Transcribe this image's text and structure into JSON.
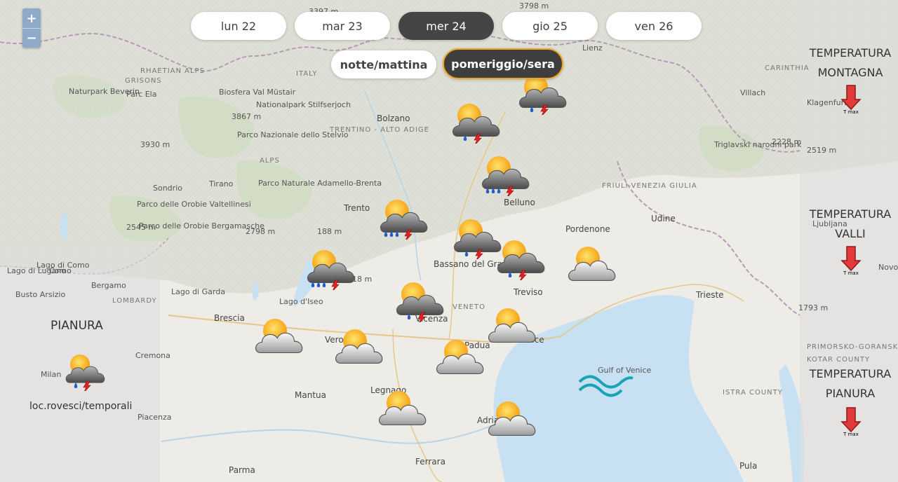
{
  "days": [
    "lun 22",
    "mar 23",
    "mer 24",
    "gio 25",
    "ven 26"
  ],
  "active_day": 2,
  "periods": [
    "notte/mattina",
    "pomeriggio/sera"
  ],
  "active_period": 1,
  "zoom": {
    "in": "+",
    "out": "−"
  },
  "right_panel": [
    {
      "title_1": "TEMPERATURA",
      "title_2": "MONTAGNA",
      "tmax": "T max"
    },
    {
      "title_1": "TEMPERATURA",
      "title_2": "VALLI",
      "tmax": "T max"
    },
    {
      "title_1": "TEMPERATURA",
      "title_2": "PIANURA",
      "tmax": "T max"
    }
  ],
  "left_panel": {
    "title": "PIANURA",
    "legend": "loc.rovesci/temporali"
  },
  "place_labels": [
    "Lienz",
    "Villach",
    "Klagenfurt",
    "CARINTHIA",
    "Bolzano",
    "ITALY",
    "TRENTINO - ALTO ADIGE",
    "Naturpark Beverin",
    "Parc Ela",
    "GRISONS",
    "RHAETIAN ALPS",
    "Biosfera Val Müstair",
    "Nationalpark Stilfserjoch",
    "Parco Nazionale dello Stelvio",
    "Parco Naturale Adamello-Brenta",
    "Sondrio",
    "Tirano",
    "Parco delle Orobie Valtellinesi",
    "Parco delle Orobie Bergamasche",
    "Trento",
    "Belluno",
    "FRIULI-VENEZIA GIULIA",
    "Udine",
    "Pordenone",
    "Bassano del Grappa",
    "Treviso",
    "VENETO",
    "Vicenza",
    "Venice",
    "Trieste",
    "Triglavski narodni park",
    "Ljubljana",
    "Como",
    "Bergamo",
    "LOMBARDY",
    "Busto Arsizio",
    "Brescia",
    "Lago di Garda",
    "Lago d'Iseo",
    "Verona",
    "Padua",
    "Legnago",
    "Mantua",
    "Cremona",
    "Piacenza",
    "Parma",
    "Ferrara",
    "Adria",
    "Pula",
    "ISTRA COUNTY",
    "Gulf of Venice",
    "Milan",
    "Lago di Lugano",
    "Lago di Como",
    "Novo",
    "3867 m",
    "3930 m",
    "2545 m",
    "2798 m",
    "188 m",
    "2218 m",
    "2228 m",
    "2519 m",
    "1793 m",
    "3397 m",
    "3798 m",
    "ALPS",
    "PRIMORSKO-GORANSKA",
    "KOTAR COUNTY"
  ],
  "weather_icons": [
    "cloud-storm-rain",
    "cloud-storm-rain",
    "cloud-storm-heavy-rain",
    "cloud-storm-heavy-rain",
    "cloud-storm-rain",
    "cloud-storm-rain",
    "cloud-storm-heavy-rain",
    "cloud-storm-rain",
    "sun-cloud",
    "sun-cloud",
    "sun-cloud",
    "sun-cloud",
    "sun-cloud",
    "sun-cloud",
    "sun-cloud",
    "cloud-storm-rain-small",
    "sea-waves"
  ],
  "colors": {
    "sea": "#c8dff0",
    "land": "#ecebe7",
    "active_pill": "#454545",
    "period_border": "#f2a51c",
    "thermometer": "#e23a3a"
  }
}
